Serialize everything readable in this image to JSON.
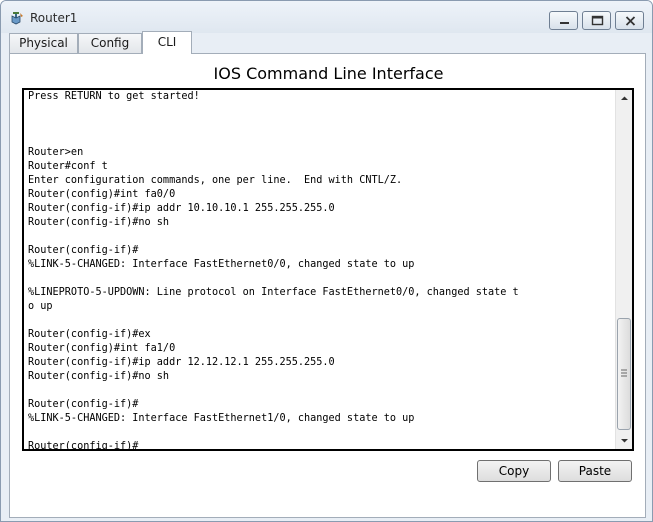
{
  "window": {
    "title": "Router1",
    "icon": "router-icon"
  },
  "tabs": [
    {
      "label": "Physical",
      "active": false
    },
    {
      "label": "Config",
      "active": false
    },
    {
      "label": "CLI",
      "active": true
    }
  ],
  "cli": {
    "heading": "IOS Command Line Interface",
    "lines": [
      "Press RETURN to get started!",
      "",
      "",
      "",
      "Router>en",
      "Router#conf t",
      "Enter configuration commands, one per line.  End with CNTL/Z.",
      "Router(config)#int fa0/0",
      "Router(config-if)#ip addr 10.10.10.1 255.255.255.0",
      "Router(config-if)#no sh",
      "",
      "Router(config-if)#",
      "%LINK-5-CHANGED: Interface FastEthernet0/0, changed state to up",
      "",
      "%LINEPROTO-5-UPDOWN: Line protocol on Interface FastEthernet0/0, changed state t",
      "o up",
      "",
      "Router(config-if)#ex",
      "Router(config)#int fa1/0",
      "Router(config-if)#ip addr 12.12.12.1 255.255.255.0",
      "Router(config-if)#no sh",
      "",
      "Router(config-if)#",
      "%LINK-5-CHANGED: Interface FastEthernet1/0, changed state to up",
      "",
      "Router(config-if)#"
    ]
  },
  "buttons": {
    "copy": "Copy",
    "paste": "Paste"
  }
}
